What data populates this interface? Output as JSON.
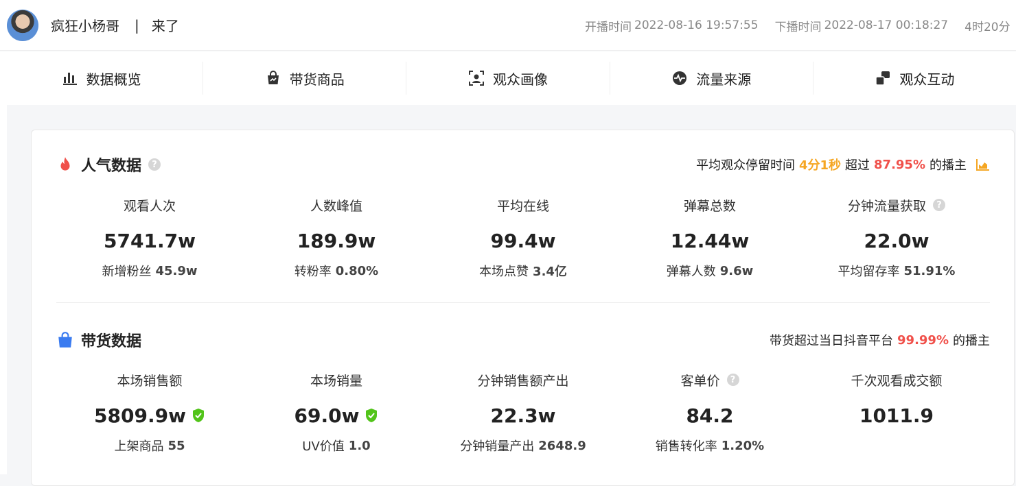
{
  "header": {
    "streamer_name": "疯狂小杨哥",
    "separator": "|",
    "stream_title": "来了",
    "start_label": "开播时间",
    "start_time": "2022-08-16 19:57:55",
    "end_label": "下播时间",
    "end_time": "2022-08-17 00:18:27",
    "duration": "4时20分"
  },
  "tabs": [
    {
      "label": "数据概览",
      "icon": "bar-chart-icon"
    },
    {
      "label": "带货商品",
      "icon": "shopping-bag-icon"
    },
    {
      "label": "观众画像",
      "icon": "portrait-icon"
    },
    {
      "label": "流量来源",
      "icon": "pulse-icon"
    },
    {
      "label": "观众互动",
      "icon": "interaction-icon"
    }
  ],
  "popularity": {
    "title": "人气数据",
    "help": "?",
    "note_prefix": "平均观众停留时间",
    "note_time": "4分1秒",
    "note_mid": "超过",
    "note_percent": "87.95%",
    "note_suffix": "的播主",
    "metrics": [
      {
        "label": "观看人次",
        "value": "5741.7w",
        "sub_label": "新增粉丝",
        "sub_value": "45.9w"
      },
      {
        "label": "人数峰值",
        "value": "189.9w",
        "sub_label": "转粉率",
        "sub_value": "0.80%"
      },
      {
        "label": "平均在线",
        "value": "99.4w",
        "sub_label": "本场点赞",
        "sub_value": "3.4亿"
      },
      {
        "label": "弹幕总数",
        "value": "12.44w",
        "sub_label": "弹幕人数",
        "sub_value": "9.6w"
      },
      {
        "label": "分钟流量获取",
        "value": "22.0w",
        "sub_label": "平均留存率",
        "sub_value": "51.91%"
      }
    ]
  },
  "sales": {
    "title": "带货数据",
    "note_prefix": "带货超过当日抖音平台",
    "note_percent": "99.99%",
    "note_suffix": "的播主",
    "metrics": [
      {
        "label": "本场销售额",
        "value": "5809.9w",
        "sub_label": "上架商品",
        "sub_value": "55"
      },
      {
        "label": "本场销量",
        "value": "69.0w",
        "sub_label": "UV价值",
        "sub_value": "1.0"
      },
      {
        "label": "分钟销售额产出",
        "value": "22.3w",
        "sub_label": "分钟销量产出",
        "sub_value": "2648.9"
      },
      {
        "label": "客单价",
        "value": "84.2",
        "sub_label": "销售转化率",
        "sub_value": "1.20%"
      },
      {
        "label": "千次观看成交额",
        "value": "1011.9",
        "sub_label": "",
        "sub_value": ""
      }
    ]
  },
  "colors": {
    "accent_orange": "#f5a623",
    "accent_red": "#f0504a",
    "verified_green": "#52c41a",
    "bag_blue": "#3a7bf0",
    "fire_red": "#f0504a"
  }
}
